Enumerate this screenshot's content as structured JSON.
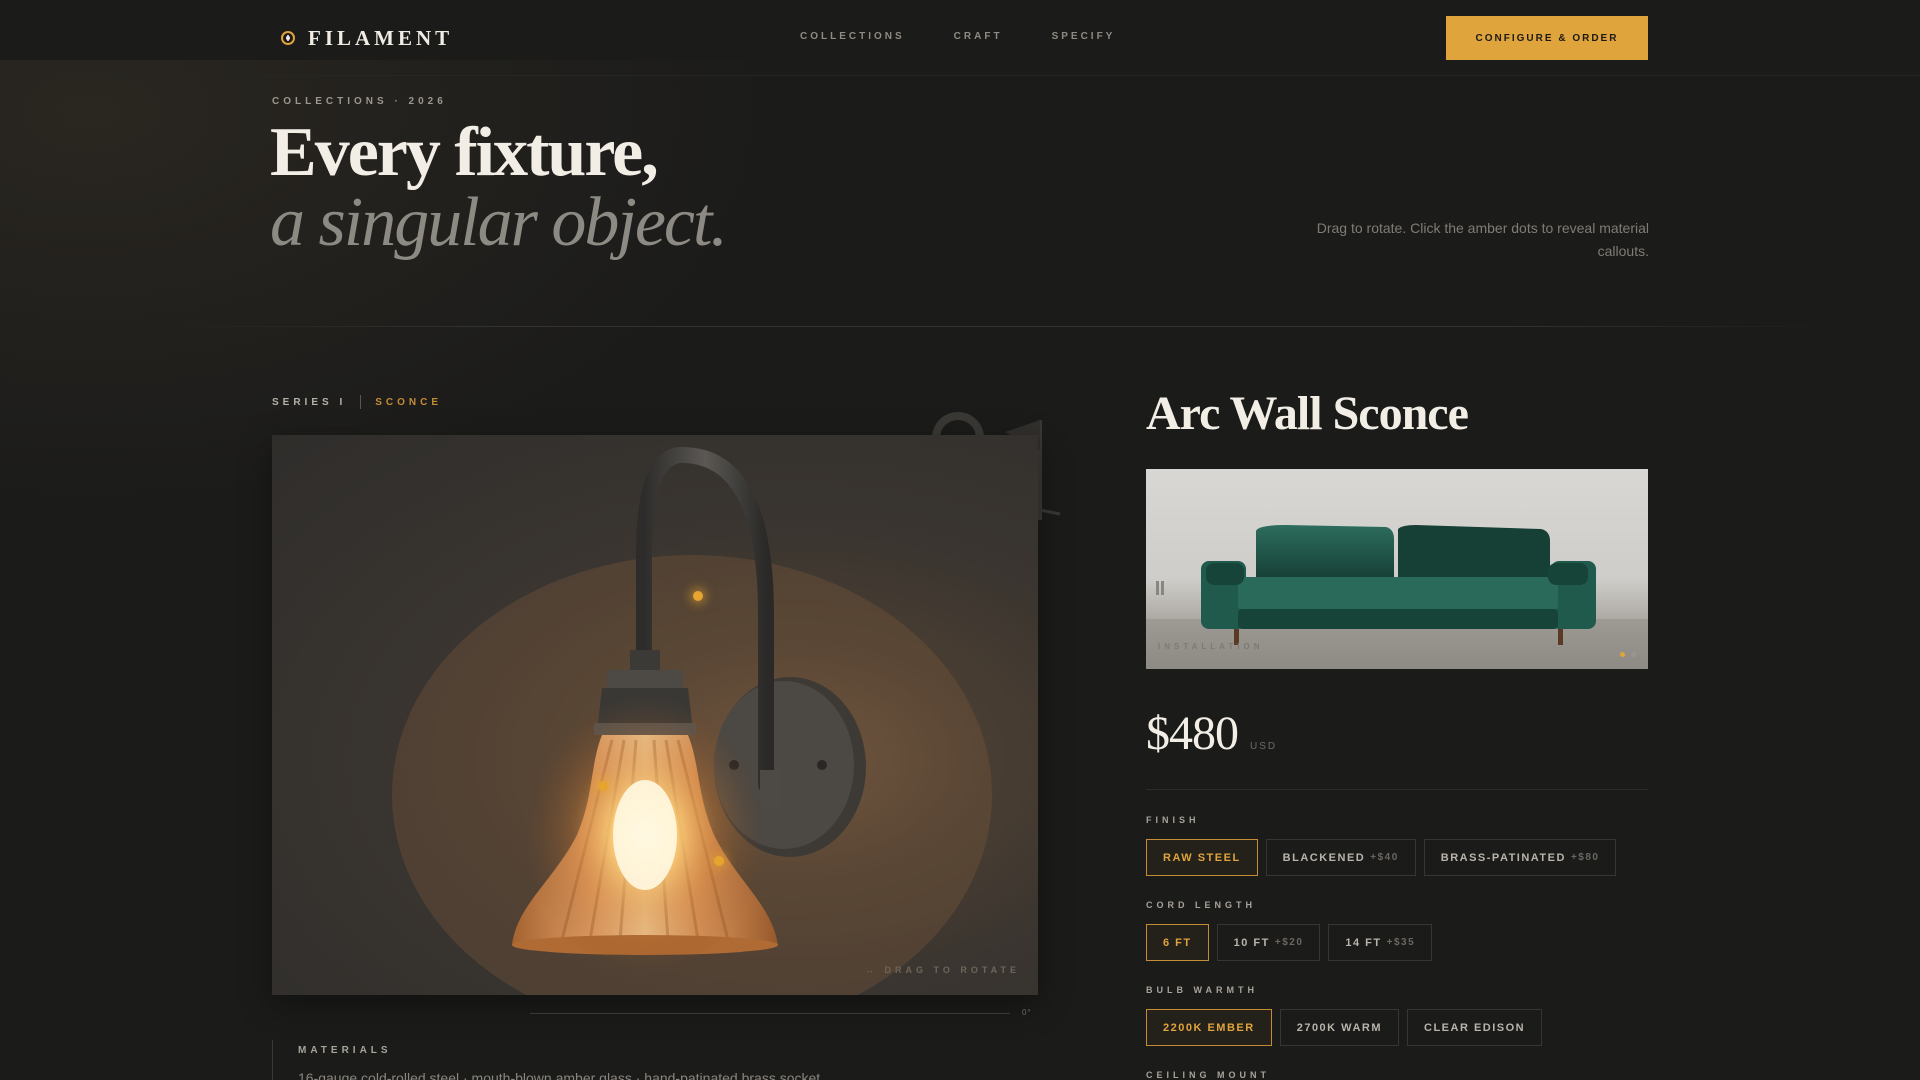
{
  "brand": {
    "name": "FILAMENT",
    "icon": "bulb-icon"
  },
  "nav": {
    "items": [
      "COLLECTIONS",
      "CRAFT",
      "SPECIFY"
    ]
  },
  "cta": {
    "label": "CONFIGURE & ORDER"
  },
  "hero": {
    "eyebrow": "COLLECTIONS · 2026",
    "title": "Every fixture,",
    "subtitle": "a singular object.",
    "hint": "Drag to rotate. Click the amber dots to reveal material callouts."
  },
  "product": {
    "series": "SERIES I",
    "type": "SCONCE",
    "name": "Arc Wall Sconce",
    "drag_hint": "↔ DRAG TO ROTATE",
    "angle": "0°",
    "install_label": "INSTALLATION",
    "price": "$480",
    "currency": "USD",
    "materials_label": "MATERIALS",
    "materials_text": "16-gauge cold-rolled steel · mouth-blown amber glass · hand-patinated brass socket"
  },
  "options": {
    "finish": {
      "label": "FINISH",
      "choices": [
        {
          "name": "RAW STEEL",
          "delta": "",
          "selected": true
        },
        {
          "name": "BLACKENED",
          "delta": "+$40",
          "selected": false
        },
        {
          "name": "BRASS-PATINATED",
          "delta": "+$80",
          "selected": false
        }
      ]
    },
    "cord": {
      "label": "CORD LENGTH",
      "choices": [
        {
          "name": "6 FT",
          "delta": "",
          "selected": true
        },
        {
          "name": "10 FT",
          "delta": "+$20",
          "selected": false
        },
        {
          "name": "14 FT",
          "delta": "+$35",
          "selected": false
        }
      ]
    },
    "bulb": {
      "label": "BULB WARMTH",
      "choices": [
        {
          "name": "2200K EMBER",
          "delta": "",
          "selected": true
        },
        {
          "name": "2700K WARM",
          "delta": "",
          "selected": false
        },
        {
          "name": "CLEAR EDISON",
          "delta": "",
          "selected": false
        }
      ]
    },
    "mount": {
      "label": "CEILING MOUNT"
    }
  },
  "colors": {
    "accent": "#e0a43c",
    "background": "#1b1b1a"
  }
}
